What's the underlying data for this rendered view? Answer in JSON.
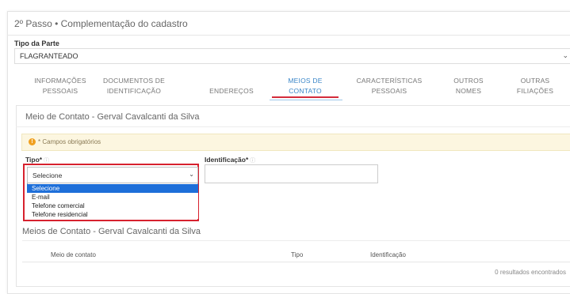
{
  "step_title": "2º Passo • Complementação do cadastro",
  "party": {
    "label": "Tipo da Parte",
    "value": "FLAGRANTEADO"
  },
  "tabs": [
    {
      "line1": "INFORMAÇÕES",
      "line2": "PESSOAIS",
      "active": false
    },
    {
      "line1": "DOCUMENTOS DE",
      "line2": "IDENTIFICAÇÃO",
      "active": false
    },
    {
      "line1": "ENDEREÇOS",
      "line2": "",
      "active": false
    },
    {
      "line1": "MEIOS DE",
      "line2": "CONTATO",
      "active": true
    },
    {
      "line1": "CARACTERÍSTICAS",
      "line2": "PESSOAIS",
      "active": false
    },
    {
      "line1": "OUTROS",
      "line2": "NOMES",
      "active": false
    },
    {
      "line1": "OUTRAS",
      "line2": "FILIAÇÕES",
      "active": false
    }
  ],
  "form": {
    "title": "Meio de Contato - Gerval Cavalcanti da Silva",
    "required_notice": "* Campos obrigatórios",
    "tipo_label": "Tipo*",
    "ident_label": "Identificação*",
    "tipo_value": "Selecione",
    "tipo_options": [
      "Selecione",
      "E-mail",
      "Telefone comercial",
      "Telefone residencial"
    ]
  },
  "list": {
    "title": "Meios de Contato - Gerval Cavalcanti da Silva",
    "columns": [
      "Meio de contato",
      "Tipo",
      "Identificação"
    ],
    "results_text": "0 resultados encontrados"
  },
  "colors": {
    "active_tab": "#3a86c8",
    "highlight_red": "#d7212e",
    "option_selected": "#1e6fd9",
    "notice_bg": "#fcf6e0"
  }
}
